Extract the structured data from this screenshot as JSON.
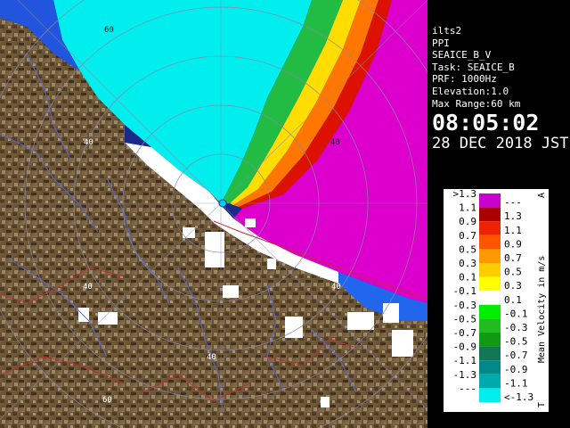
{
  "panel": {
    "site": "ilts2",
    "product": "PPI",
    "data_name": "SEAICE_B_V",
    "task_line": "Task: SEAICE_B",
    "prf_line": "PRF: 1000Hz",
    "elevation_line": "Elevation:1.0",
    "range_line": "Max Range:60 km",
    "time": "08:05:02",
    "date": "28 DEC 2018 JST"
  },
  "legend": {
    "title": "Mean Velocity in m/s",
    "arrow_top": "A",
    "arrow_bottom": "T",
    "rows": [
      {
        "left": ">1.3",
        "right": "---",
        "color": "#cc00cc"
      },
      {
        "left": "1.1",
        "right": "1.3",
        "color": "#aa0000"
      },
      {
        "left": "0.9",
        "right": "1.1",
        "color": "#ee2200"
      },
      {
        "left": "0.7",
        "right": "0.9",
        "color": "#ff5500"
      },
      {
        "left": "0.5",
        "right": "0.7",
        "color": "#ff9900"
      },
      {
        "left": "0.3",
        "right": "0.5",
        "color": "#ffcc00"
      },
      {
        "left": "0.1",
        "right": "0.3",
        "color": "#ffff00"
      },
      {
        "left": "-0.1",
        "right": "0.1",
        "color": "#ffffff"
      },
      {
        "left": "-0.3",
        "right": "-0.1",
        "color": "#00ee00"
      },
      {
        "left": "-0.5",
        "right": "-0.3",
        "color": "#22bb22"
      },
      {
        "left": "-0.7",
        "right": "-0.5",
        "color": "#119911"
      },
      {
        "left": "-0.9",
        "right": "-0.7",
        "color": "#117755"
      },
      {
        "left": "-1.1",
        "right": "-0.9",
        "color": "#008888"
      },
      {
        "left": "-1.3",
        "right": "-1.1",
        "color": "#00aaaa"
      },
      {
        "left": "---",
        "right": "<-1.3",
        "color": "#00eeee"
      }
    ]
  },
  "range_labels": {
    "r60_nw": "60",
    "r40_ne": "40",
    "r40_w": "40",
    "r40_sw": "40",
    "r40_s": "40",
    "r40_se": "40",
    "r60_s": "60"
  },
  "colors": {
    "approaching_cyan": "#00eeee",
    "receding_magenta": "#dd00cc",
    "land_brown": "#6b5637",
    "coast_road_red": "#c03030",
    "river_blue": "#5a6ad0",
    "sea_blue": "#1f5ad8"
  }
}
